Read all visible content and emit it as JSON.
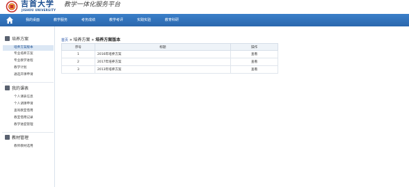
{
  "header": {
    "school_name_cn": "吉首大学",
    "school_name_en": "JISHOU UNIVERSITY",
    "platform_title": "教学一体化服务平台"
  },
  "nav": {
    "items": [
      "我的桌面",
      "教学服务",
      "考务成绩",
      "教学考评",
      "实践实验",
      "教育科研"
    ]
  },
  "sidebar": {
    "groups": [
      {
        "title": "培养方案",
        "items": [
          "培养方案版本",
          "专业培养方案",
          "专业教学进程",
          "教学计划",
          "通选开课申请"
        ]
      },
      {
        "title": "我的课表",
        "items": [
          "个人课表信息",
          "个人调课申请",
          "查询教室借用",
          "教室借用记录",
          "教学进度管理"
        ]
      },
      {
        "title": "教材管理",
        "items": [
          "教师教材选用"
        ]
      }
    ]
  },
  "breadcrumb": {
    "home": "首页",
    "separator1": "»",
    "section": "培养方案",
    "separator2": "»",
    "current": "培养方案版本"
  },
  "table": {
    "headers": [
      "序号",
      "标题",
      "操作"
    ],
    "rows": [
      [
        "1",
        "2016年培养方案",
        "查看"
      ],
      [
        "2",
        "2017年培养方案",
        "查看"
      ],
      [
        "3",
        "2013年培养方案",
        "查看"
      ]
    ]
  },
  "colors": {
    "nav": "#2b67ad",
    "brand": "#1d4f91",
    "active": "#dbe7f4"
  }
}
